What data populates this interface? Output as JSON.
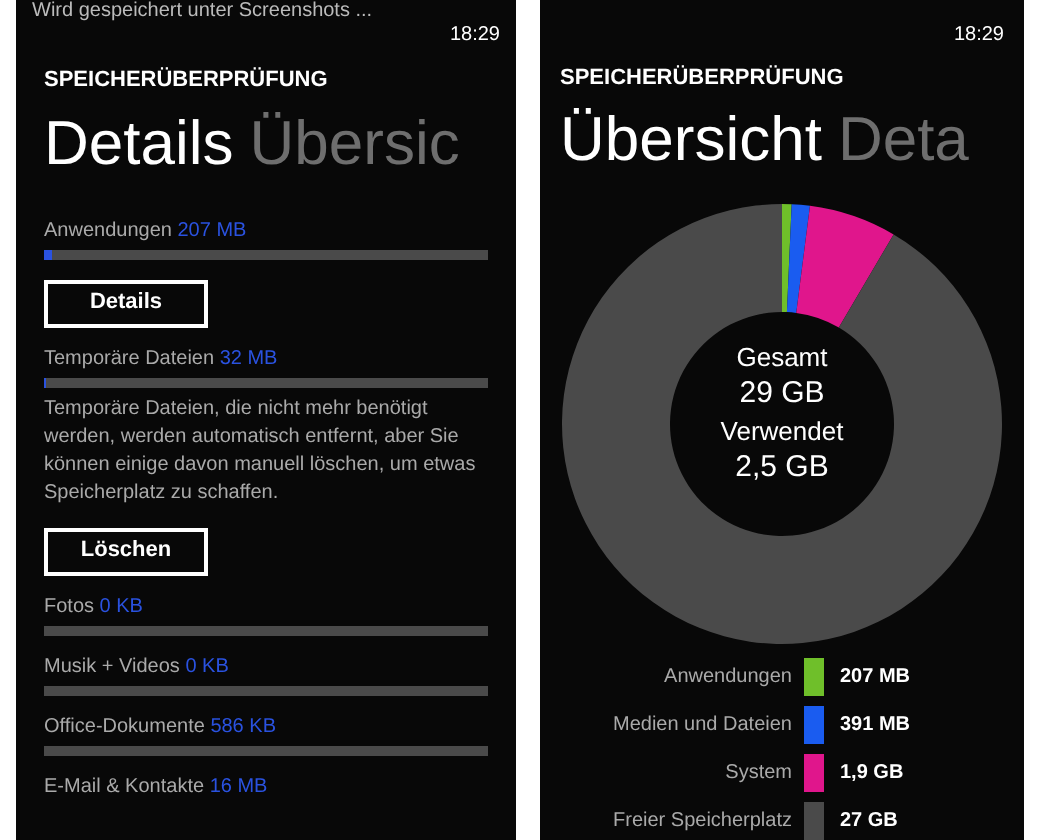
{
  "details_screen": {
    "notification": "Wird gespeichert unter Screenshots ...",
    "time": "18:29",
    "app_title": "SPEICHERÜBERPRÜFUNG",
    "pivots": [
      {
        "label": "Details",
        "selected": true
      },
      {
        "label": "Übersic",
        "selected": false
      }
    ],
    "rows": [
      {
        "kind": "bar",
        "label": "Anwendungen",
        "value": "207 MB",
        "level": 0.02,
        "button": "Details"
      },
      {
        "kind": "bar",
        "label": "Temporäre Dateien",
        "value": "32 MB",
        "level": 0.005,
        "description": "Temporäre Dateien, die nicht mehr benötigt werden, werden automatisch entfernt, aber Sie können einige davon manuell löschen, um etwas Speicherplatz zu schaffen.",
        "button": "Löschen"
      },
      {
        "kind": "bar",
        "label": "Fotos",
        "value": "0 KB"
      },
      {
        "kind": "bar",
        "label": "Musik + Videos",
        "value": "0 KB"
      },
      {
        "kind": "bar",
        "label": "Office-Dokumente",
        "value": "586 KB"
      },
      {
        "kind": "label",
        "label": "E-Mail & Kontakte",
        "value": "16 MB"
      }
    ]
  },
  "overview_screen": {
    "time": "18:29",
    "app_title": "SPEICHERÜBERPRÜFUNG",
    "pivots": [
      {
        "label": "Übersicht",
        "selected": true
      },
      {
        "label": "Deta",
        "selected": false
      }
    ],
    "center": [
      "Gesamt",
      "29 GB",
      "Verwendet",
      "2,5 GB"
    ],
    "chart_data": {
      "type": "donut",
      "categories": [
        "Anwendungen",
        "Medien und Dateien",
        "System",
        "Freier Speicherplatz"
      ],
      "values": [
        0.7,
        1.33,
        6.44,
        91.53
      ]
    },
    "legend": [
      {
        "value": "207 MB",
        "color": "#6fbf2a"
      },
      {
        "value": "391 MB",
        "color": "#1a5cf0"
      },
      {
        "value": "1,9 GB",
        "color": "#e0168c"
      },
      {
        "value": "27 GB",
        "color": "#4a4a4a"
      }
    ]
  }
}
